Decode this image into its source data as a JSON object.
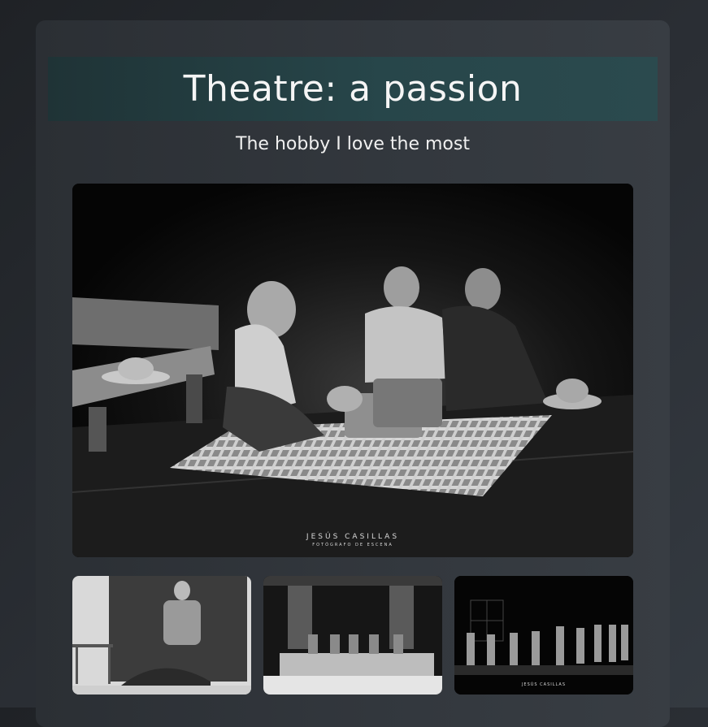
{
  "header": {
    "title": "Theatre: a passion",
    "subtitle": "The hobby I love the most"
  },
  "gallery": {
    "main_image": {
      "watermark_name": "JESÚS CASILLAS",
      "watermark_role": "FOTÓGRAFO DE ESCENA"
    },
    "thumbnails": [
      {
        "watermark_name": ""
      },
      {
        "watermark_name": ""
      },
      {
        "watermark_name": "JESÚS CASILLAS"
      }
    ]
  },
  "colors": {
    "page_background": "#2b2f35",
    "card_background": "#33383e",
    "title_bar_background": "#27464a",
    "text": "#f1f1f1"
  }
}
